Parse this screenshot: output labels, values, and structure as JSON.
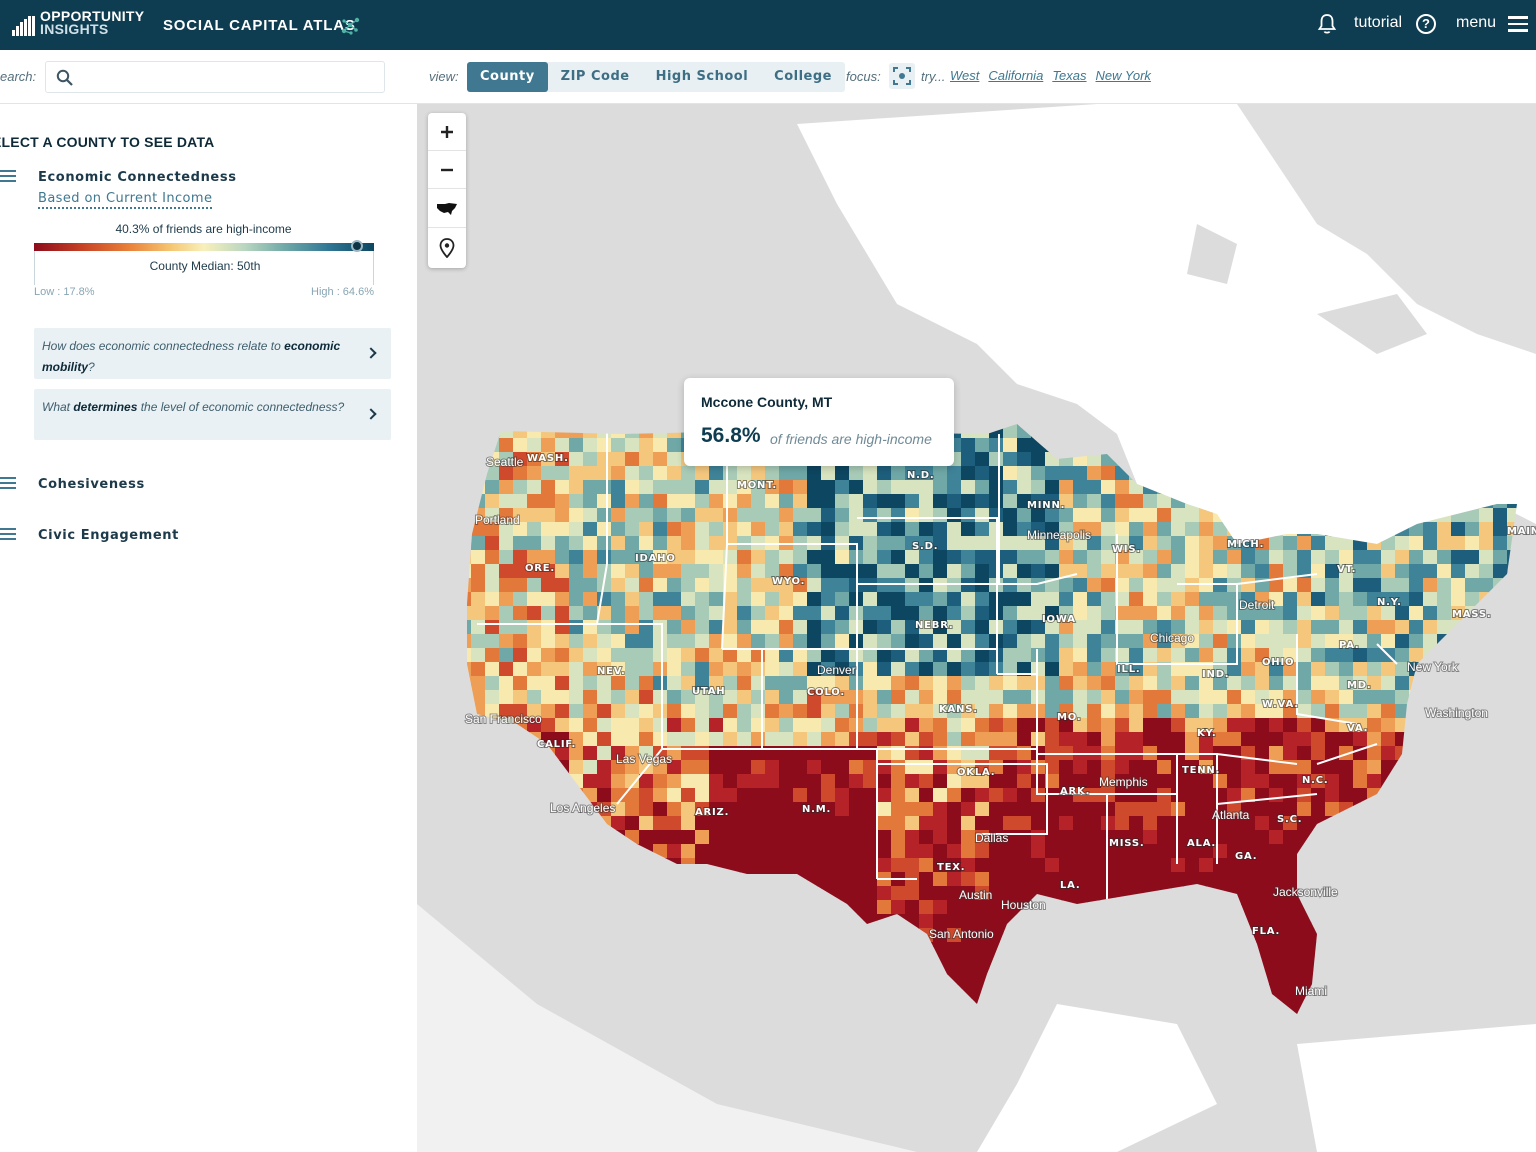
{
  "header": {
    "brand_line1": "OPPORTUNITY",
    "brand_line2": "INSIGHTS",
    "app_title": "SOCIAL CAPITAL ATLAS",
    "tutorial_label": "tutorial",
    "help_glyph": "?",
    "menu_label": "menu",
    "icons": [
      "bars-logo-icon",
      "network-icon",
      "bell-icon",
      "help-circle-icon",
      "hamburger-icon"
    ]
  },
  "toolbar": {
    "search_label": "earch:",
    "search_placeholder": "",
    "view_label": "view:",
    "view_tabs": [
      {
        "label": "County",
        "active": true
      },
      {
        "label": "ZIP Code",
        "active": false
      },
      {
        "label": "High School",
        "active": false
      },
      {
        "label": "College",
        "active": false
      }
    ],
    "focus_label": "focus:",
    "try_label": "try...",
    "try_links": [
      "West",
      "California",
      "Texas",
      "New York"
    ]
  },
  "panel": {
    "title": "ELECT A COUNTY TO SEE DATA",
    "economic": {
      "title": "Economic Connectedness",
      "subtitle": "Based on Current Income",
      "scale_caption": "40.3% of friends are high-income",
      "median_text": "County Median: 50th",
      "low_label": "Low : 17.8%",
      "high_label": "High : 64.6%",
      "marker_fraction": 0.95
    },
    "questions": [
      {
        "pre": "How does economic connectedness relate to ",
        "bold": "economic mobility",
        "post": "?"
      },
      {
        "pre": "What ",
        "bold": "determines",
        "post": " the level of economic connectedness?"
      }
    ],
    "sections": [
      "Cohesiveness",
      "Civic Engagement"
    ]
  },
  "map": {
    "zoom_controls": [
      "zoom-in-icon",
      "zoom-out-icon",
      "usa-icon",
      "location-pin-icon"
    ],
    "tooltip": {
      "name": "Mccone County, MT",
      "value": "56.8%",
      "desc": "of friends are high-income"
    },
    "state_labels": [
      "WASH.",
      "MONT.",
      "N.D.",
      "MINN.",
      "S.D.",
      "IDAHO",
      "ORE.",
      "WYO.",
      "NEBR.",
      "IOWA",
      "WIS.",
      "MICH.",
      "VT.",
      "MAIN",
      "N.Y.",
      "MASS.",
      "PA.",
      "OHIO",
      "IND.",
      "ILL.",
      "NEV.",
      "UTAH",
      "COLO.",
      "KANS.",
      "MO.",
      "W.VA.",
      "MD.",
      "VA.",
      "KY.",
      "CALIF.",
      "ARIZ.",
      "N.M.",
      "OKLA.",
      "ARK.",
      "TENN.",
      "N.C.",
      "S.C.",
      "MISS.",
      "ALA.",
      "GA.",
      "TEX.",
      "LA.",
      "FLA."
    ],
    "city_labels": [
      "Seattle",
      "Portland",
      "Minneapolis",
      "Detroit",
      "Chicago",
      "New York",
      "Washington",
      "Denver",
      "San Francisco",
      "Las Vegas",
      "Los Angeles",
      "Dallas",
      "Austin",
      "Houston",
      "San Antonio",
      "Atlanta",
      "Jacksonville",
      "Miami",
      "Memphis"
    ],
    "colors": {
      "water": "#ffffff",
      "land": "#dcdcdc",
      "low": "#8d0c1c",
      "high": "#0d4661"
    }
  }
}
